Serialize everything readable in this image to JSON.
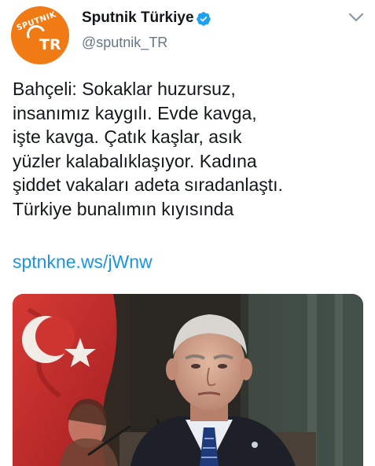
{
  "account": {
    "display_name": "Sputnik Türkiye",
    "handle": "@sputnik_TR",
    "avatar_text_top": "SPUTNIK",
    "avatar_text_bottom": "TR",
    "verified": true
  },
  "tweet": {
    "lines": [
      "Bahçeli:  Sokaklar huzursuz,",
      "insanımız kaygılı. Evde kavga,",
      "işte kavga. Çatık kaşlar, asık",
      "yüzler kalabalıklaşıyor.  Kadına",
      "şiddet vakaları adeta sıradanlaştı.",
      "Türkiye bunalımın kıyısında"
    ],
    "link": "sptnkne.ws/jWnw"
  },
  "colors": {
    "brand_orange": "#f07a14",
    "verified_blue": "#1da1f2",
    "link_blue": "#1b95e0",
    "handle_gray": "#657786"
  },
  "icons": {
    "verified": "verified-badge-icon",
    "more": "chevron-down-icon"
  }
}
